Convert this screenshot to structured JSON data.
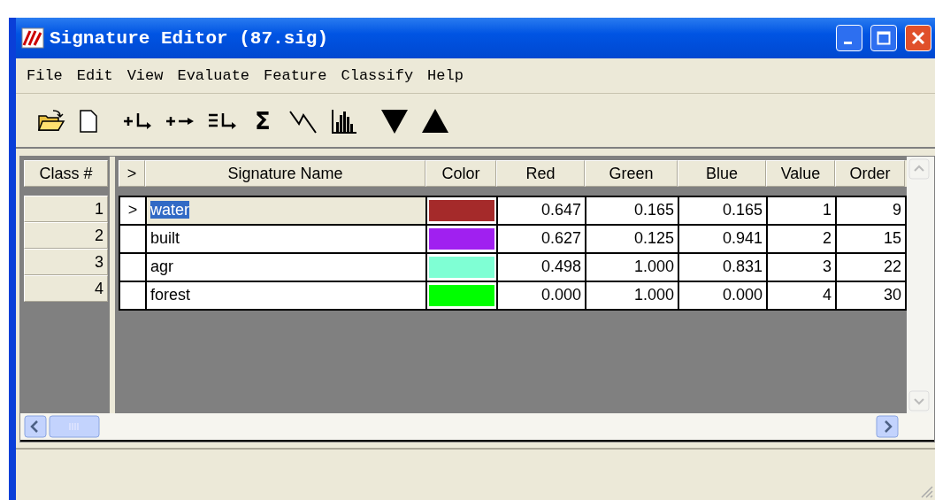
{
  "window": {
    "title": "Signature Editor (87.sig)"
  },
  "menu": [
    "File",
    "Edit",
    "View",
    "Evaluate",
    "Feature",
    "Classify",
    "Help"
  ],
  "toolbar": [
    {
      "kind": "open"
    },
    {
      "kind": "new"
    },
    {
      "kind": "add"
    },
    {
      "kind": "replace"
    },
    {
      "kind": "merge"
    },
    {
      "kind": "text",
      "label": "Σ"
    },
    {
      "kind": "mean-plot"
    },
    {
      "kind": "histogram"
    },
    {
      "kind": "down"
    },
    {
      "kind": "up"
    }
  ],
  "table": {
    "columns": [
      "Class #",
      ">",
      "Signature Name",
      "Color",
      "Red",
      "Green",
      "Blue",
      "Value",
      "Order"
    ],
    "rows": [
      {
        "class": "1",
        "marker": ">",
        "name": "water",
        "color": "#a52a2a",
        "red": "0.647",
        "green": "0.165",
        "blue": "0.165",
        "value": "1",
        "order": "9",
        "selected": true
      },
      {
        "class": "2",
        "name": "built",
        "color": "#a020f0",
        "red": "0.627",
        "green": "0.125",
        "blue": "0.941",
        "value": "2",
        "order": "15",
        "selected": false
      },
      {
        "class": "3",
        "name": "agr",
        "color": "#7fffd4",
        "red": "0.498",
        "green": "1.000",
        "blue": "0.831",
        "value": "3",
        "order": "22",
        "selected": false
      },
      {
        "class": "4",
        "name": "forest",
        "color": "#00ff00",
        "red": "0.000",
        "green": "1.000",
        "blue": "0.000",
        "value": "4",
        "order": "30",
        "selected": false
      }
    ]
  }
}
